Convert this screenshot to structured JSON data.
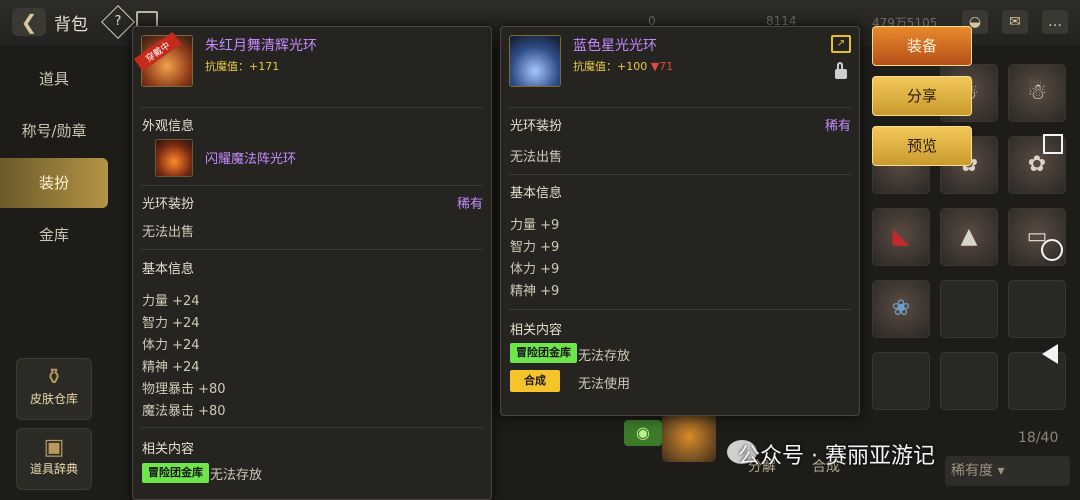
{
  "top_bar": {
    "back_icon": "back-arrow-icon",
    "title": "背包",
    "help_label": "?",
    "faded_numbers": [
      "0",
      "8114",
      "479万5105"
    ],
    "right_icons": [
      "pouch-icon",
      "mail-icon",
      "chat-icon"
    ]
  },
  "left_menu": {
    "items": [
      {
        "label": "道具"
      },
      {
        "label": "称号/勋章"
      },
      {
        "label": "装扮",
        "active": true
      },
      {
        "label": "金库"
      }
    ],
    "skin_storage_label": "皮肤仓库",
    "item_dictionary_label": "道具辞典"
  },
  "equipped_item": {
    "equipped_tag": "穿戴中",
    "name": "朱红月舞清辉光环",
    "stat": "抗魔值：+171",
    "appearance_title": "外观信息",
    "appearance_name": "闪耀魔法阵光环",
    "category": "光环装扮",
    "rarity": "稀有",
    "sell_status": "无法出售",
    "basic_title": "基本信息",
    "stats": [
      "力量 +24",
      "智力 +24",
      "体力 +24",
      "精神 +24",
      "物理暴击 +80",
      "魔法暴击 +80"
    ],
    "related_title": "相关内容",
    "related_tag": "冒险团金库",
    "related_text": "无法存放"
  },
  "compare_item": {
    "name": "蓝色星光光环",
    "stat_prefix": "抗魔值：+100",
    "stat_diff": "▼71",
    "category": "光环装扮",
    "rarity": "稀有",
    "sell_status": "无法出售",
    "basic_title": "基本信息",
    "stats": [
      "力量 +9",
      "智力 +9",
      "体力 +9",
      "精神 +9"
    ],
    "related_title": "相关内容",
    "related_tag": "冒险团金库",
    "related_text": "无法存放",
    "synth_tag": "合成",
    "synth_text": "无法使用"
  },
  "actions": {
    "equip": "装备",
    "share": "分享",
    "preview": "预览"
  },
  "background": {
    "page": "18/40",
    "sort_label": "稀有度",
    "bottom_buttons": [
      "分解",
      "合成"
    ]
  },
  "watermark": "公众号 · 赛丽亚游记",
  "colors": {
    "rare_purple": "#c48bff",
    "stat_yellow": "#e8c94a",
    "decrease_red": "#e04a3c",
    "active_gold": "#b49445"
  }
}
